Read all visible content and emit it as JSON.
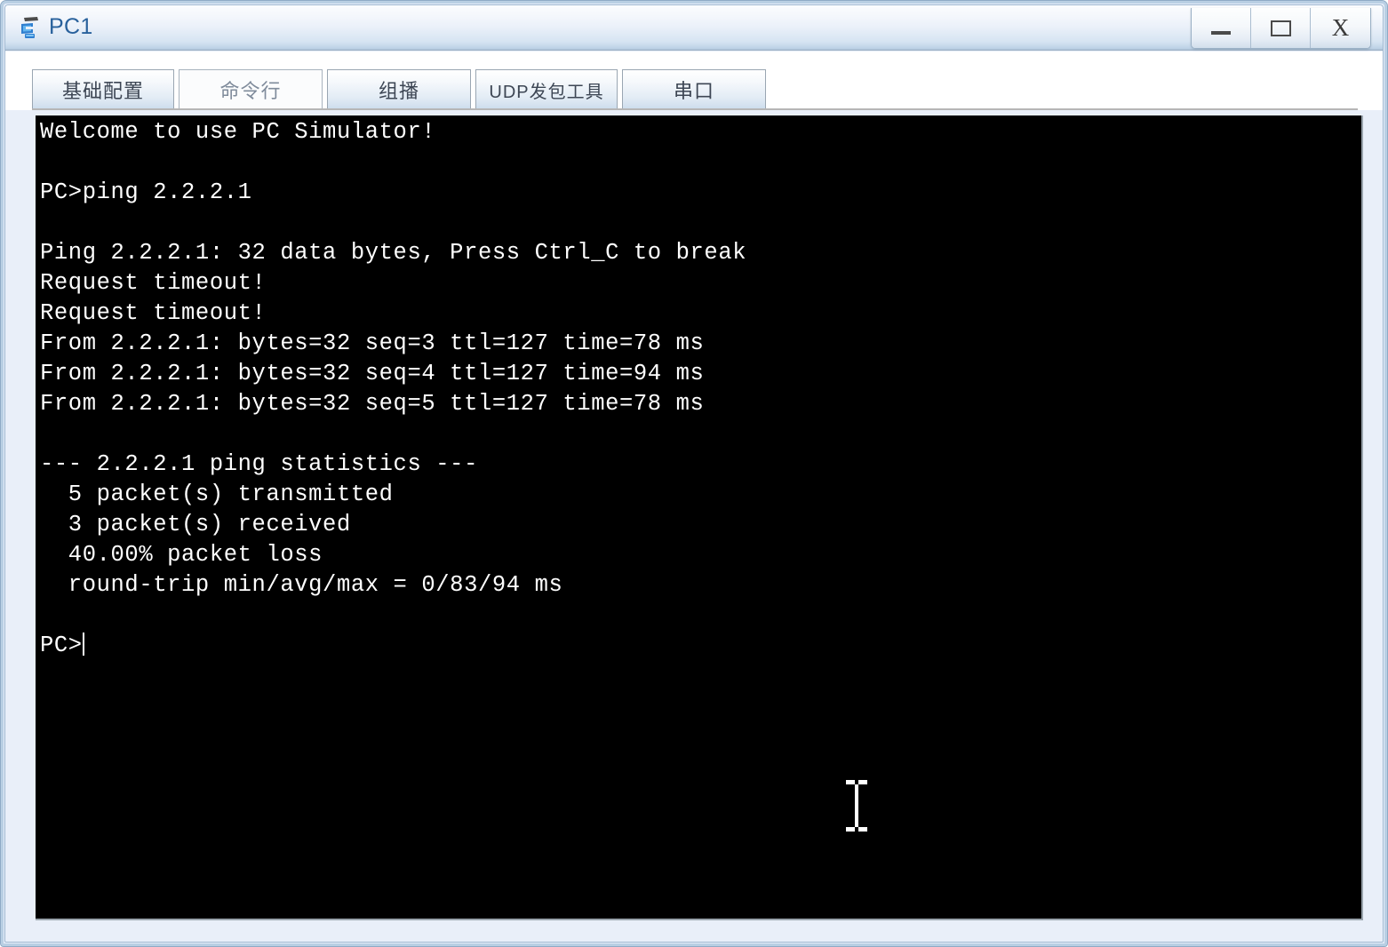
{
  "window": {
    "title": "PC1",
    "icon": "pc-simulator-icon",
    "accent_color": "#29619c",
    "border_color": "#8fabc6",
    "controls": {
      "minimize": "_",
      "maximize": "□",
      "close": "X"
    }
  },
  "tabs": [
    {
      "label": "基础配置",
      "active": false
    },
    {
      "label": "命令行",
      "active": true
    },
    {
      "label": "组播",
      "active": false
    },
    {
      "label": "UDP发包工具",
      "active": false
    },
    {
      "label": "串口",
      "active": false
    }
  ],
  "terminal": {
    "background_color": "#000000",
    "text_color": "#ffffff",
    "lines": [
      "Welcome to use PC Simulator!",
      "",
      "PC>ping 2.2.2.1",
      "",
      "Ping 2.2.2.1: 32 data bytes, Press Ctrl_C to break",
      "Request timeout!",
      "Request timeout!",
      "From 2.2.2.1: bytes=32 seq=3 ttl=127 time=78 ms",
      "From 2.2.2.1: bytes=32 seq=4 ttl=127 time=94 ms",
      "From 2.2.2.1: bytes=32 seq=5 ttl=127 time=78 ms",
      "",
      "--- 2.2.2.1 ping statistics ---",
      "  5 packet(s) transmitted",
      "  3 packet(s) received",
      "  40.00% packet loss",
      "  round-trip min/avg/max = 0/83/94 ms",
      "",
      "PC>"
    ],
    "prompt": "PC>",
    "command": "ping 2.2.2.1",
    "target_host": "2.2.2.1",
    "data_bytes": "32",
    "packets_transmitted": "5",
    "packets_received": "3",
    "packet_loss": "40.00%",
    "round_trip": "0/83/94 ms",
    "replies": [
      {
        "from": "2.2.2.1",
        "bytes": "32",
        "seq": "3",
        "ttl": "127",
        "time": "78 ms"
      },
      {
        "from": "2.2.2.1",
        "bytes": "32",
        "seq": "4",
        "ttl": "127",
        "time": "94 ms"
      },
      {
        "from": "2.2.2.1",
        "bytes": "32",
        "seq": "5",
        "ttl": "127",
        "time": "78 ms"
      }
    ],
    "timeouts": [
      "Request timeout!",
      "Request timeout!"
    ]
  },
  "cursor": {
    "type": "i-beam"
  }
}
